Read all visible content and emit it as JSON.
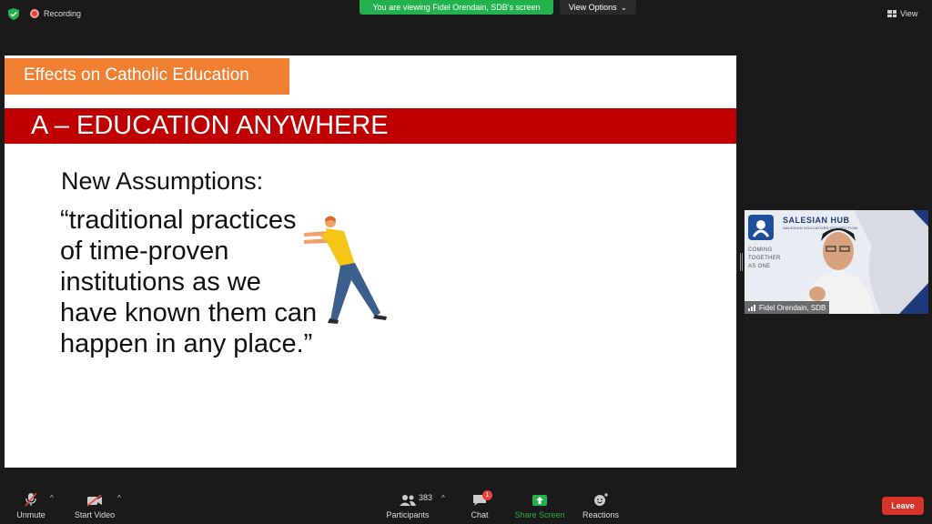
{
  "top_bar": {
    "recording_label": "Recording",
    "viewing_banner": "You are viewing Fidel Orendain, SDB's screen",
    "view_options_label": "View Options",
    "view_label": "View"
  },
  "slide": {
    "tab_title": "Effects on Catholic Education",
    "band_title": "A – EDUCATION ANYWHERE",
    "subtitle": "New Assumptions:",
    "quote": "“traditional practices of time-proven institutions as we have known them can happen in any place.”"
  },
  "video_tile": {
    "title": "SALESIAN HUB",
    "subtitle": "SALESIAN EDUCATORS CONNECTION",
    "coming_1": "COMING",
    "coming_2": "TOGETHER",
    "coming_3": "AS ONE",
    "participant_name": "Fidel Orendain, SDB"
  },
  "bottom_bar": {
    "unmute_label": "Unmute",
    "start_video_label": "Start Video",
    "participants_label": "Participants",
    "participants_count": "383",
    "chat_label": "Chat",
    "chat_badge": "1",
    "share_screen_label": "Share Screen",
    "reactions_label": "Reactions",
    "leave_label": "Leave"
  },
  "colors": {
    "orange": "#f07f32",
    "red_band": "#c00000",
    "green": "#22b14c",
    "leave": "#d9342b"
  }
}
